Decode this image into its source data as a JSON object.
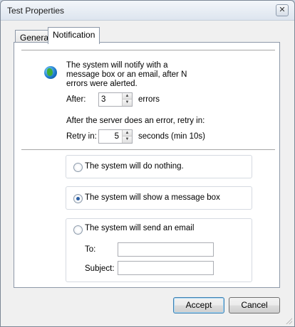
{
  "window": {
    "title": "Test Properties",
    "close_symbol": "✕"
  },
  "tabs": [
    {
      "label": "General",
      "active": false
    },
    {
      "label": "Notification",
      "active": true
    }
  ],
  "notification": {
    "description": "The system will notify with a message box or an email, after N errors were alerted.",
    "after_label": "After:",
    "after_value": "3",
    "after_unit": "errors",
    "retry_description": "After the server does an error, retry in:",
    "retry_label": "Retry in:",
    "retry_value": "5",
    "retry_unit": "seconds (min 10s)",
    "options": [
      {
        "label": "The system will do nothing.",
        "selected": false
      },
      {
        "label": "The system will show a message box",
        "selected": true
      },
      {
        "label": "The system will send an email",
        "selected": false
      }
    ],
    "email": {
      "to_label": "To:",
      "to_value": "",
      "subject_label": "Subject:",
      "subject_value": ""
    }
  },
  "buttons": {
    "accept": "Accept",
    "cancel": "Cancel"
  },
  "icons": {
    "globe": "globe-icon",
    "spin_up": "▲",
    "spin_down": "▼"
  },
  "colors": {
    "accent": "#2a5ea3",
    "default_button_border": "#3c7fb1"
  }
}
